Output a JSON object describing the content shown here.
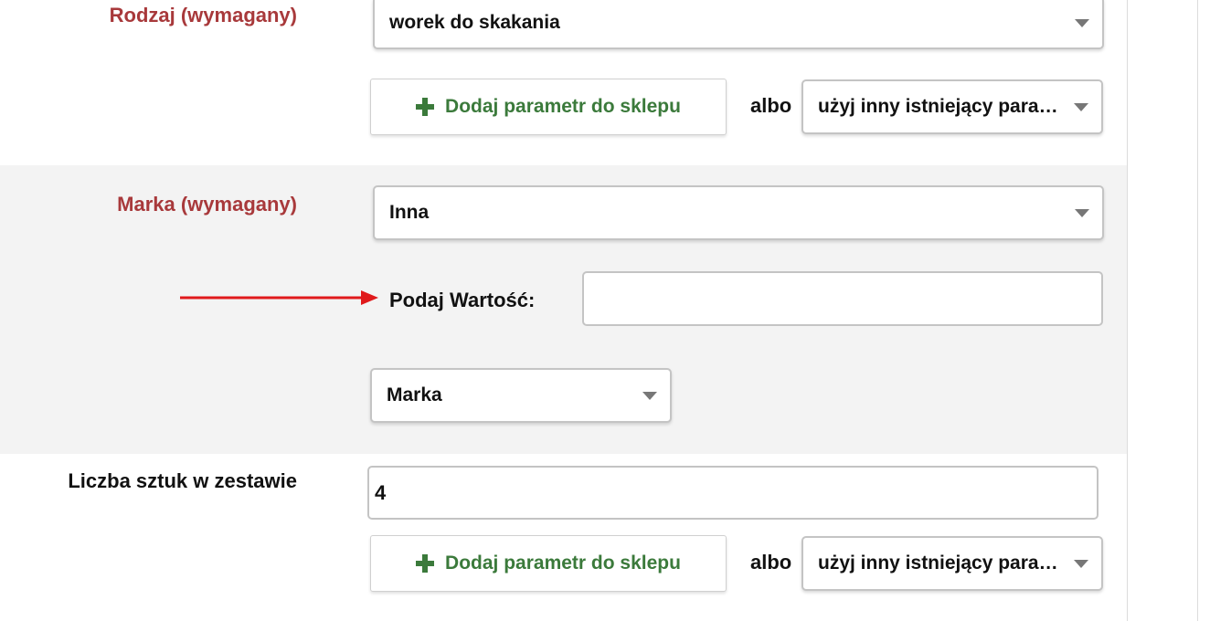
{
  "rows": {
    "rodzaj": {
      "label": "Rodzaj (wymagany)",
      "selected": "worek do skakania",
      "add_button_label": "Dodaj parametr do sklepu",
      "or_text": "albo",
      "existing_param_selected": "użyj inny istniejący parametr"
    },
    "marka": {
      "label": "Marka (wymagany)",
      "selected": "Inna",
      "custom_value_label": "Podaj Wartość:",
      "custom_value": "",
      "param_select": "Marka"
    },
    "liczba": {
      "label": "Liczba sztuk w zestawie",
      "value": "4",
      "add_button_label": "Dodaj parametr do sklepu",
      "or_text": "albo",
      "existing_param_selected": "użyj inny istniejący parametr"
    }
  },
  "colors": {
    "required_label": "#a8393b",
    "add_button_text": "#3b7a3b",
    "annotation_arrow": "#e0191b",
    "highlight_band": "#f3f3f3"
  }
}
